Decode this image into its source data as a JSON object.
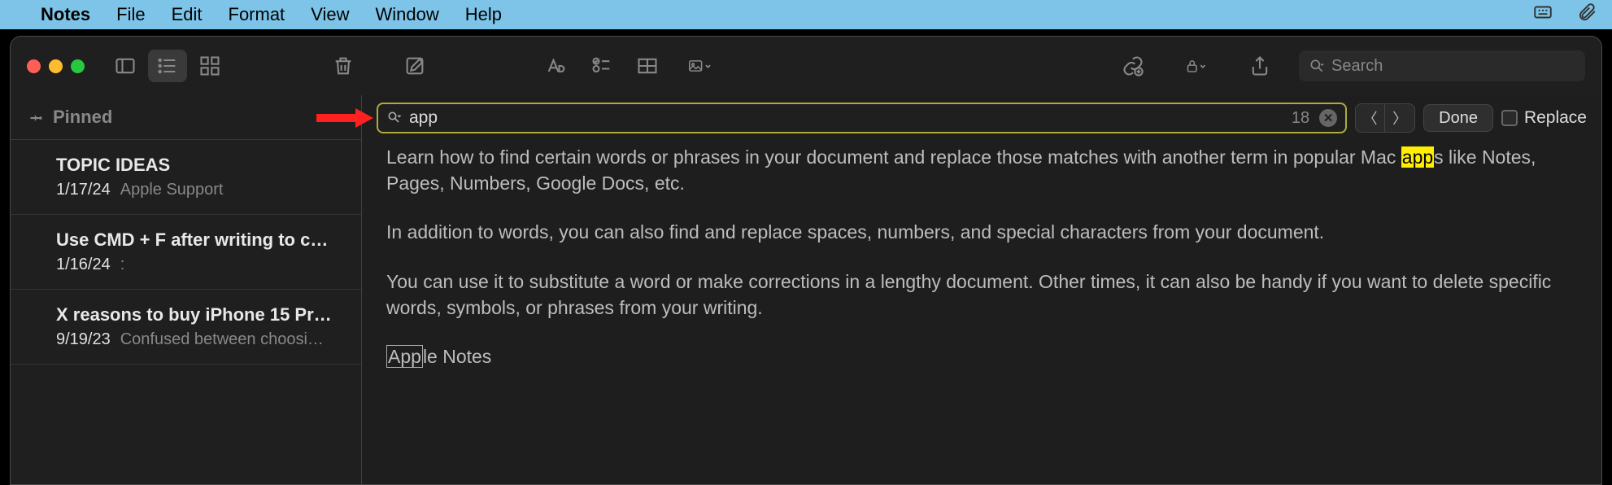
{
  "menubar": {
    "app": "Notes",
    "items": [
      "File",
      "Edit",
      "Format",
      "View",
      "Window",
      "Help"
    ]
  },
  "toolbar": {
    "search_placeholder": "Search"
  },
  "find": {
    "value": "app",
    "count": "18",
    "done": "Done",
    "replace": "Replace"
  },
  "sidebar": {
    "pinned": "Pinned",
    "notes": [
      {
        "title": "TOPIC IDEAS",
        "date": "1/17/24",
        "preview": "Apple Support"
      },
      {
        "title": "Use CMD + F after writing to c…",
        "date": "1/16/24",
        "preview": ":"
      },
      {
        "title": "X reasons to buy iPhone 15 Pr…",
        "date": "9/19/23",
        "preview": "Confused between choosi…"
      }
    ]
  },
  "note": {
    "p1_a": "Learn how to find certain words or phrases in your document and replace those matches with another term in popular Mac ",
    "p1_hl": "app",
    "p1_b": "s like Notes, Pages, Numbers, Google Docs, etc.",
    "p2": "In addition to words, you can also find and replace spaces, numbers, and special characters from your document.",
    "p3": "You can use it to substitute a word or make corrections in a lengthy document. Other times, it can also be handy if you want to delete specific words, symbols, or phrases from your writing.",
    "p4_hl": "App",
    "p4_b": "le Notes"
  }
}
